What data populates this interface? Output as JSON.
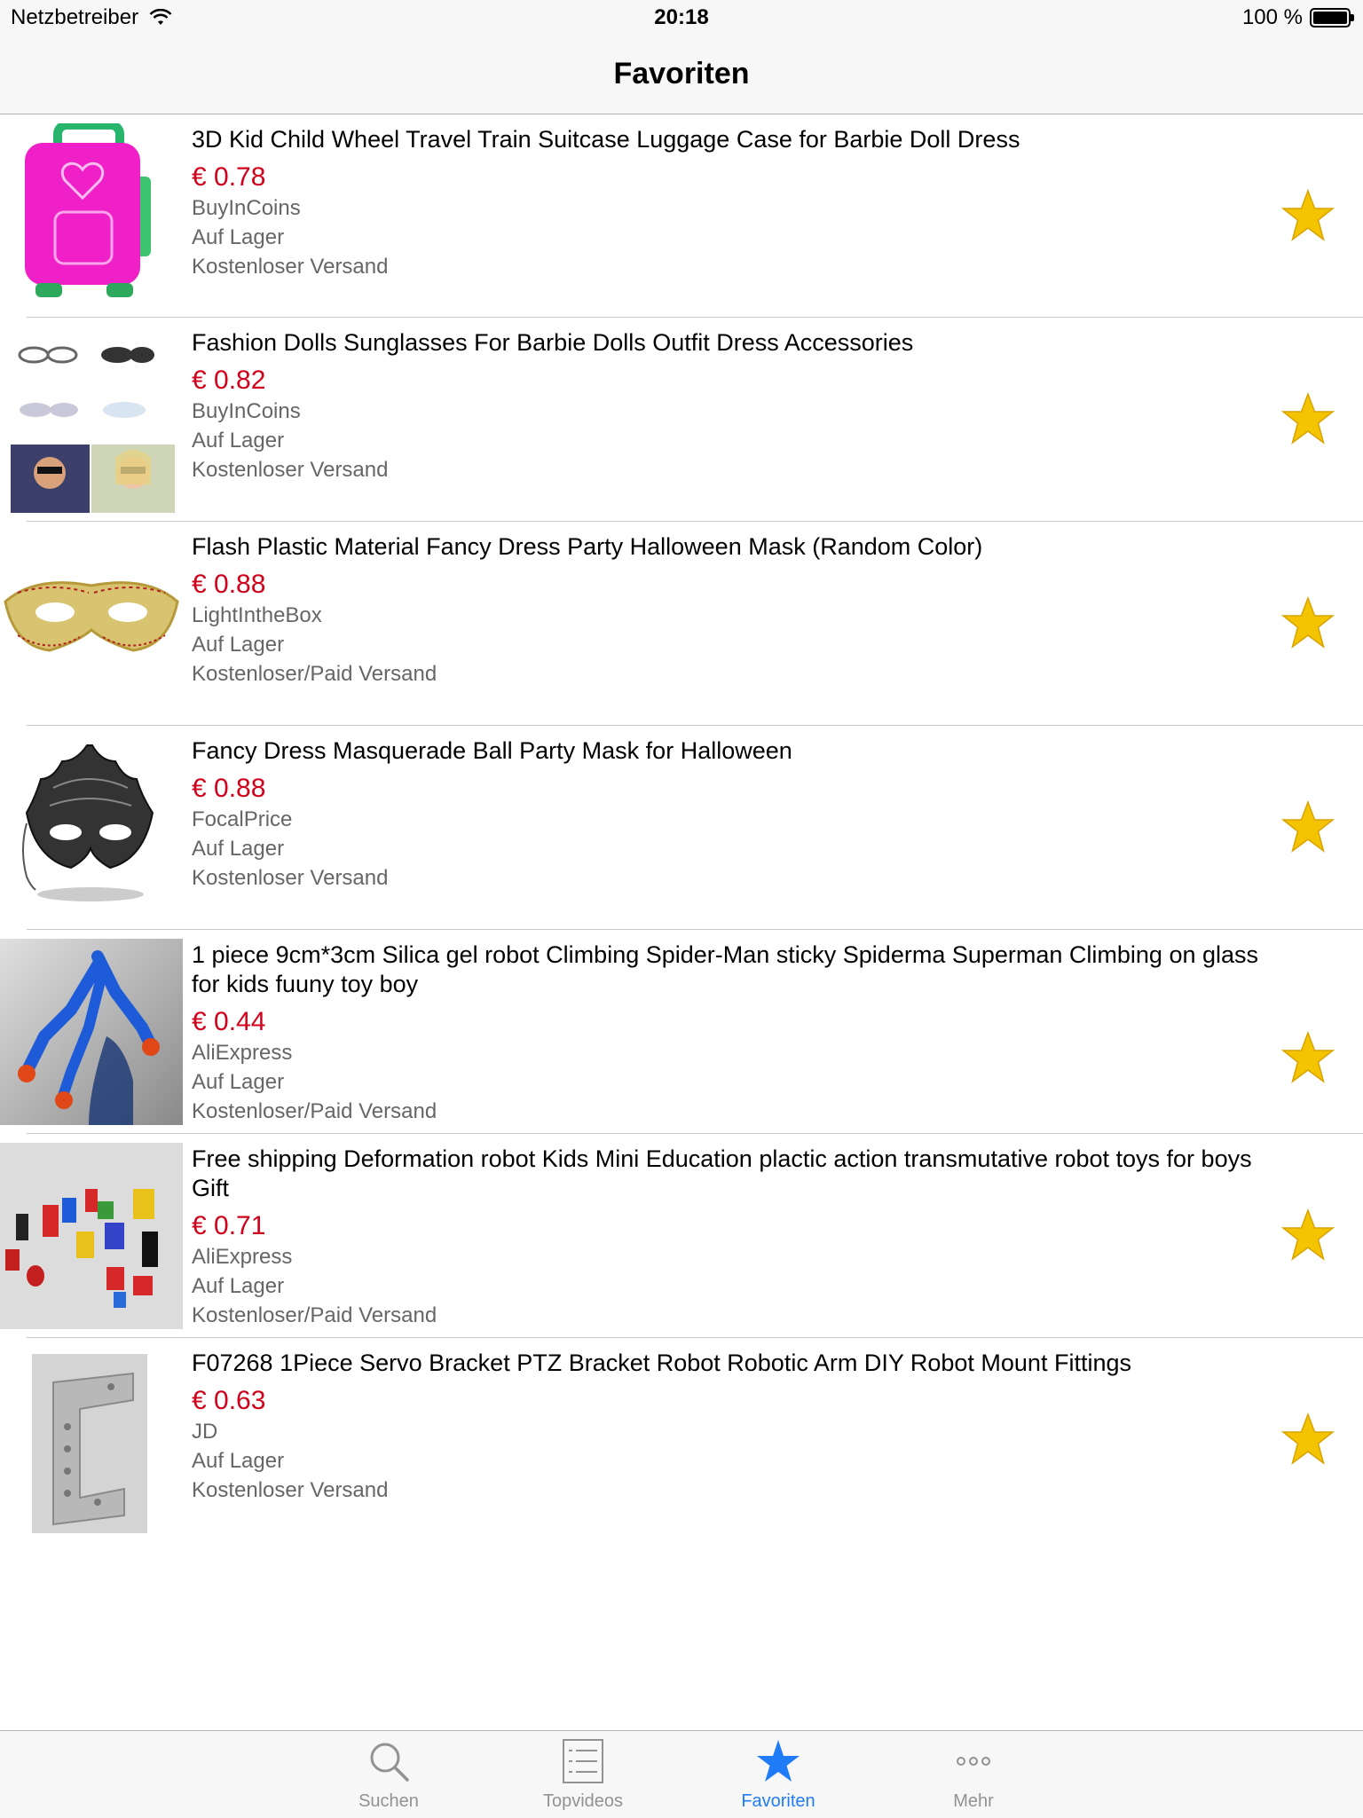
{
  "status_bar": {
    "carrier": "Netzbetreiber",
    "time": "20:18",
    "battery": "100 %"
  },
  "nav": {
    "title": "Favoriten"
  },
  "colors": {
    "price": "#d0021b",
    "accent": "#1f7cf6",
    "star": "#f5c400"
  },
  "items": [
    {
      "title": "3D Kid Child Wheel Travel Train Suitcase Luggage Case for Barbie Doll Dress",
      "price": "€ 0.78",
      "store": "BuyInCoins",
      "stock": "Auf Lager",
      "shipping": "Kostenloser Versand",
      "image": "pink-suitcase"
    },
    {
      "title": "Fashion Dolls Sunglasses For Barbie Dolls Outfit Dress Accessories",
      "price": "€ 0.82",
      "store": "BuyInCoins",
      "stock": "Auf Lager",
      "shipping": "Kostenloser Versand",
      "image": "doll-sunglasses"
    },
    {
      "title": "Flash Plastic Material Fancy Dress Party Halloween Mask (Random Color)",
      "price": "€ 0.88",
      "store": "LightIntheBox",
      "stock": "Auf Lager",
      "shipping": "Kostenloser/Paid Versand",
      "image": "gold-mask"
    },
    {
      "title": "Fancy Dress Masquerade Ball Party Mask for Halloween",
      "price": "€ 0.88",
      "store": "FocalPrice",
      "stock": "Auf Lager",
      "shipping": "Kostenloser Versand",
      "image": "black-mask"
    },
    {
      "title": "1 piece 9cm*3cm Silica gel robot Climbing Spider-Man sticky Spiderma Superman Climbing on glass for kids fuuny toy boy",
      "price": "€ 0.44",
      "store": "AliExpress",
      "stock": "Auf Lager",
      "shipping": "Kostenloser/Paid Versand",
      "image": "climbing-toy"
    },
    {
      "title": "Free shipping Deformation robot Kids Mini Education plactic action transmutative robot toys for boys Gift",
      "price": "€ 0.71",
      "store": "AliExpress",
      "stock": "Auf Lager",
      "shipping": "Kostenloser/Paid Versand",
      "image": "robot-toys"
    },
    {
      "title": "F07268 1Piece Servo Bracket PTZ Bracket Robot Robotic Arm DIY Robot Mount Fittings",
      "price": "€ 0.63",
      "store": "JD",
      "stock": "Auf Lager",
      "shipping": "Kostenloser Versand",
      "image": "servo-bracket"
    }
  ],
  "tabs": [
    {
      "label": "Suchen",
      "icon": "search-icon",
      "active": false
    },
    {
      "label": "Topvideos",
      "icon": "list-icon",
      "active": false
    },
    {
      "label": "Favoriten",
      "icon": "star-icon",
      "active": true
    },
    {
      "label": "Mehr",
      "icon": "more-icon",
      "active": false
    }
  ]
}
